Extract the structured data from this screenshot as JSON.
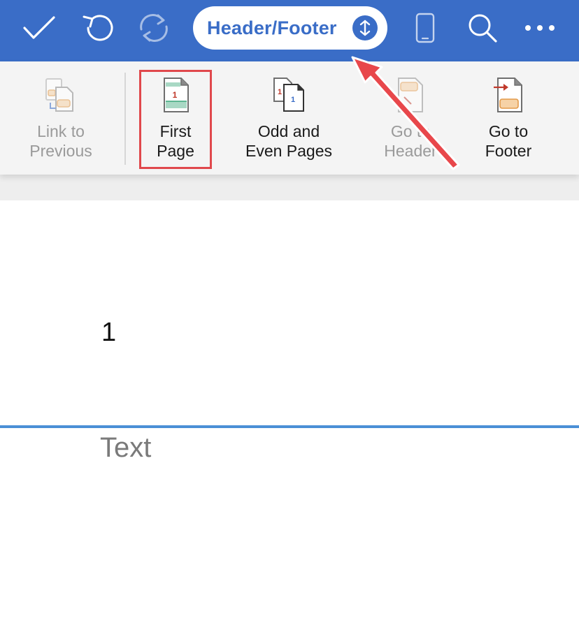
{
  "toolbar": {
    "done_icon": "checkmark-icon",
    "undo_icon": "undo-icon",
    "redo_icon": "redo-icon",
    "mode_label": "Header/Footer",
    "mode_toggle_icon": "up-down-arrows-icon",
    "view_icon": "phone-icon",
    "search_icon": "search-icon",
    "more_icon": "more-dots-icon"
  },
  "ribbon": {
    "items": [
      {
        "line1": "Link to",
        "line2": "Previous",
        "enabled": false,
        "icon": "link-to-previous-icon"
      },
      {
        "line1": "First",
        "line2": "Page",
        "enabled": true,
        "selected": true,
        "icon": "first-page-icon"
      },
      {
        "line1": "Odd and",
        "line2": "Even Pages",
        "enabled": true,
        "icon": "odd-even-pages-icon"
      },
      {
        "line1": "Go to",
        "line2": "Header",
        "enabled": false,
        "icon": "go-to-header-icon"
      },
      {
        "line1": "Go to",
        "line2": "Footer",
        "enabled": true,
        "icon": "go-to-footer-icon"
      }
    ]
  },
  "document": {
    "header_content": "1",
    "body_placeholder": "Text"
  },
  "colors": {
    "toolbar_bg": "#3a6dc7",
    "ribbon_bg": "#f4f4f4",
    "highlight": "#e0484c",
    "header_line": "#4a8fd6",
    "annotation_arrow": "#e8474b"
  }
}
